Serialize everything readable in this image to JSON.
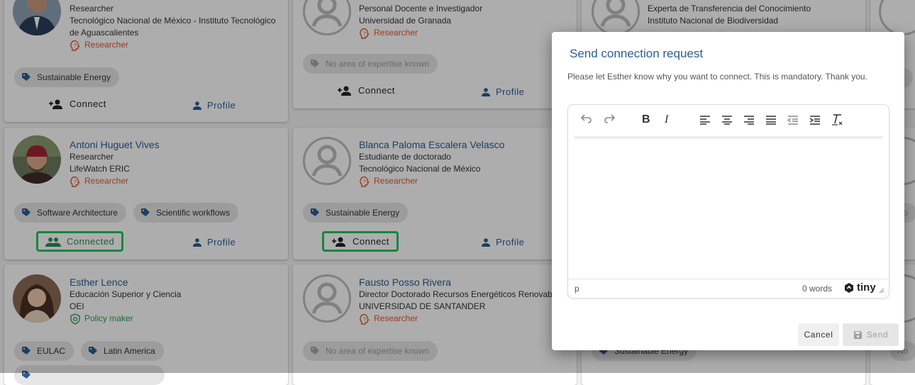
{
  "cards": {
    "c0": {
      "title": "Researcher",
      "org": "Tecnológico Nacional de México - Instituto Tecnológico",
      "org2": "de Aguascalientes",
      "role": "Researcher",
      "tags": [
        "Sustainable Energy"
      ],
      "connect": "Connect",
      "profile": "Profile"
    },
    "c1": {
      "title": "Personal Docente e Investigador",
      "org": "Universidad de Granada",
      "role": "Researcher",
      "tags": [
        "No area of expertise known"
      ],
      "connect": "Connect",
      "profile": "Profile"
    },
    "c2": {
      "title": "Experta de Transferencia del Conocimiento",
      "org": "Instituto Nacional de Biodiversidad"
    },
    "c3": {
      "name": "Antoni Huguet Vives",
      "title": "Researcher",
      "org": "LifeWatch ERIC",
      "role": "Researcher",
      "tags": [
        "Software Architecture",
        "Scientific workflows"
      ],
      "connect": "Connected",
      "profile": "Profile"
    },
    "c4": {
      "name": "Blanca Paloma Escalera Velasco",
      "title": "Estudiante de doctorado",
      "org": "Tecnológico Nacional de México",
      "role": "Researcher",
      "tags": [
        "Sustainable Energy"
      ],
      "connect": "Connect",
      "profile": "Profile"
    },
    "c5": {
      "name": "Esther Lence",
      "title": "Educación Superior y Ciencia",
      "org": "OEI",
      "role": "Policy maker",
      "tags": [
        "EULAC",
        "Latin America"
      ]
    },
    "c6": {
      "name": "Fausto Posso Rivera",
      "title": "Director Doctorado Recursos Energéticos Renovables",
      "org": "UNIVERSIDAD DE SANTANDER",
      "role": "Researcher",
      "tags": [
        "No area of expertise known"
      ]
    },
    "c7": {
      "tags": [
        "Sustainable Energy"
      ]
    },
    "edge": {
      "t1": "te",
      "t2": "No",
      "t3": "No"
    }
  },
  "dialog": {
    "title": "Send connection request",
    "description": "Please let Esther know why you want to connect. This is mandatory. Thank you.",
    "status_path": "p",
    "word_count": "0 words",
    "brand": "tiny",
    "cancel": "Cancel",
    "send": "Send"
  },
  "colors": {
    "accent": "#2a5d93",
    "researcher": "#e4572e",
    "policy": "#2e9e57",
    "highlight": "#22c55e"
  }
}
